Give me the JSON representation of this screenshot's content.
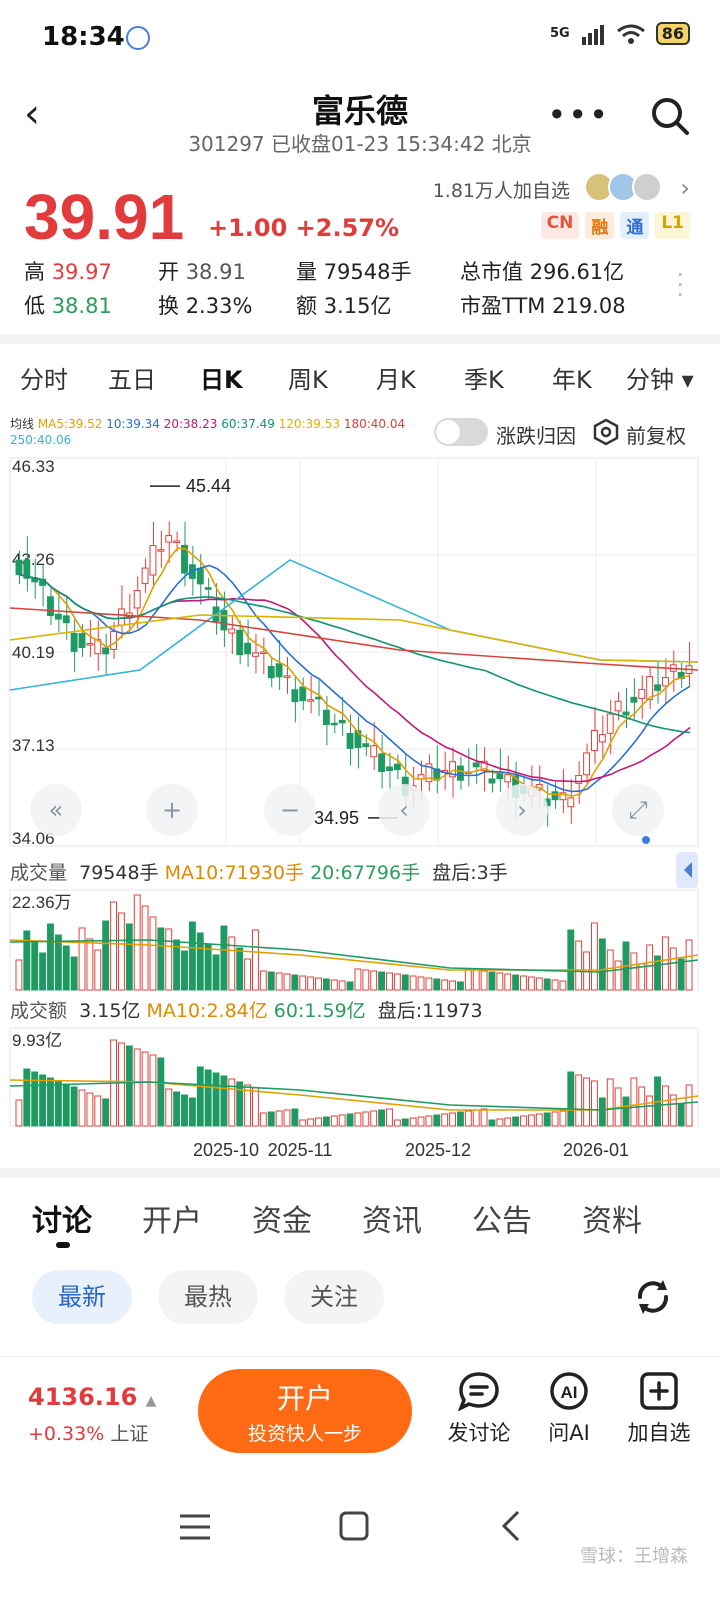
{
  "status": {
    "time": "18:34",
    "network": "5G",
    "battery": "86"
  },
  "header": {
    "title": "富乐德",
    "subtitle": "301297 已收盘01-23 15:34:42 北京"
  },
  "quote": {
    "price": "39.91",
    "change": "+1.00 +2.57%",
    "followers": "1.81万人加自选",
    "tags": [
      "CN",
      "融",
      "通",
      "L1"
    ],
    "stats": {
      "high_label": "高",
      "high": "39.97",
      "open_label": "开",
      "open": "38.91",
      "vol_label": "量",
      "vol": "79548手",
      "mcap_label": "总市值",
      "mcap": "296.61亿",
      "low_label": "低",
      "low": "38.81",
      "turn_label": "换",
      "turn": "2.33%",
      "amt_label": "额",
      "amt": "3.15亿",
      "pe_label": "市盈TTM",
      "pe": "219.08"
    }
  },
  "period_tabs": [
    "分时",
    "五日",
    "日K",
    "周K",
    "月K",
    "季K",
    "年K",
    "分钟 ▾"
  ],
  "active_period": "日K",
  "ma_legend": {
    "label": "均线",
    "items": [
      {
        "text": "MA5:39.52",
        "color": "#e0a100"
      },
      {
        "text": "10:39.34",
        "color": "#2a6fd6"
      },
      {
        "text": "20:38.23",
        "color": "#c2187a"
      },
      {
        "text": "60:37.49",
        "color": "#119472"
      },
      {
        "text": "120:39.53",
        "color": "#d9b300"
      },
      {
        "text": "180:40.04",
        "color": "#d6453d"
      },
      {
        "text": "250:40.06",
        "color": "#33b5d6"
      }
    ]
  },
  "toggle_label": "涨跌归因",
  "adjust_label": "前复权",
  "chart": {
    "y_labels": [
      "46.33",
      "43.26",
      "40.19",
      "37.13",
      "34.06"
    ],
    "high_marker": "45.44",
    "low_marker": "34.95",
    "vol_label": "成交量",
    "vol_value": "79548手",
    "vol_ma10": "MA10:71930手",
    "vol_ma20": "20:67796手",
    "vol_after": "盘后:3手",
    "vol_max": "22.36万",
    "amt_label": "成交额",
    "amt_value": "3.15亿",
    "amt_ma10": "MA10:2.84亿",
    "amt_ma60": "60:1.59亿",
    "amt_after": "盘后:11973",
    "amt_max": "9.93亿",
    "x_labels": [
      "2025-10",
      "2025-11",
      "2025-12",
      "2026-01"
    ]
  },
  "chart_data": {
    "type": "candlestick",
    "y_range": [
      34.06,
      46.33
    ],
    "x_ticks": [
      "2025-10",
      "2025-11",
      "2025-12",
      "2026-01"
    ],
    "last_close": 39.91,
    "marked_high": 45.44,
    "marked_low": 34.95,
    "ma_series": [
      {
        "name": "MA5",
        "value": 39.52
      },
      {
        "name": "10",
        "value": 39.34
      },
      {
        "name": "20",
        "value": 38.23
      },
      {
        "name": "60",
        "value": 37.49
      },
      {
        "name": "120",
        "value": 39.53
      },
      {
        "name": "180",
        "value": 40.04
      },
      {
        "name": "250",
        "value": 40.06
      }
    ]
  },
  "discussion_tabs": [
    "讨论",
    "开户",
    "资金",
    "资讯",
    "公告",
    "资料"
  ],
  "filters": [
    "最新",
    "最热",
    "关注"
  ],
  "bottom": {
    "index_value": "4136.16",
    "index_change": "+0.33%",
    "index_name": "上证",
    "open_btn": "开户",
    "open_sub": "投资快人一步",
    "actions": [
      "发讨论",
      "问AI",
      "加自选"
    ]
  },
  "watermark": "雪球：王增森"
}
